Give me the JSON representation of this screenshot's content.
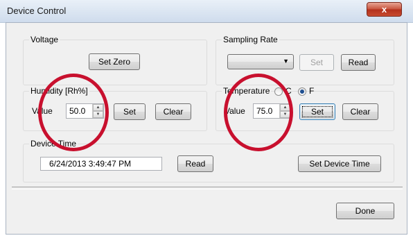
{
  "window": {
    "title": "Device Control",
    "close_label": "x"
  },
  "voltage": {
    "label": "Voltage",
    "set_zero_label": "Set Zero"
  },
  "sampling_rate": {
    "label": "Sampling Rate",
    "selected": "",
    "set_label": "Set",
    "read_label": "Read"
  },
  "humidity": {
    "label": "Humidity [Rh%]",
    "value_label": "Value",
    "value": "50.0",
    "set_label": "Set",
    "clear_label": "Clear"
  },
  "temperature": {
    "label": "Temperature",
    "unit_c_label": "C",
    "unit_f_label": "F",
    "selected_unit": "F",
    "value_label": "Value",
    "value": "75.0",
    "set_label": "Set",
    "clear_label": "Clear"
  },
  "device_time": {
    "label": "Device Time",
    "value": "6/24/2013 3:49:47 PM",
    "read_label": "Read",
    "set_label": "Set Device Time"
  },
  "footer": {
    "done_label": "Done"
  },
  "annotation": {
    "highlight_color": "#c8102e"
  },
  "icons": {
    "close": "close-icon",
    "dropdown": "chevron-down-icon",
    "spin_up": "spin-up-icon",
    "spin_down": "spin-down-icon"
  }
}
